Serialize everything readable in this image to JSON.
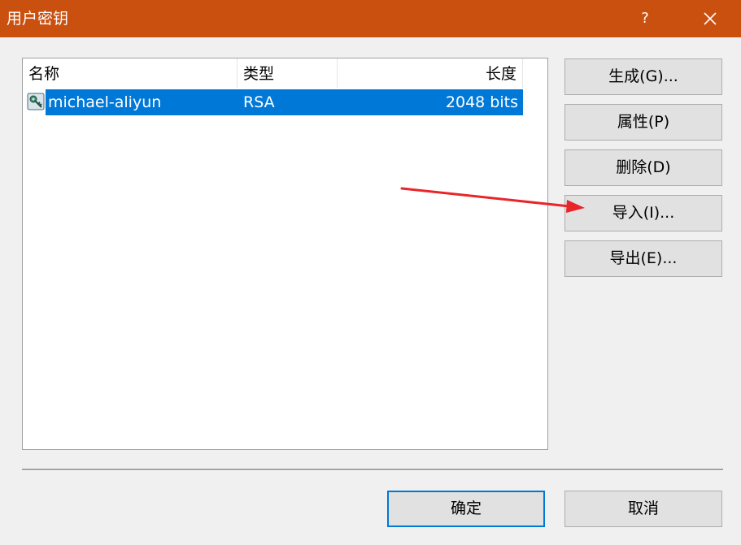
{
  "window": {
    "title": "用户密钥",
    "help_label": "?",
    "close_icon": "close-icon"
  },
  "list": {
    "columns": [
      "名称",
      "类型",
      "长度"
    ],
    "rows": [
      {
        "icon": "key-icon",
        "name": "michael-aliyun",
        "type": "RSA",
        "length": "2048 bits",
        "selected": true
      }
    ]
  },
  "side_buttons": {
    "generate": "生成(G)...",
    "properties": "属性(P)",
    "delete": "删除(D)",
    "import": "导入(I)...",
    "export": "导出(E)..."
  },
  "footer_buttons": {
    "ok": "确定",
    "cancel": "取消"
  },
  "colors": {
    "titlebar": "#ca5010",
    "selection": "#0078d7",
    "annotation_arrow": "#e8262a"
  },
  "annotation": {
    "type": "arrow",
    "points_to": "import-button"
  }
}
